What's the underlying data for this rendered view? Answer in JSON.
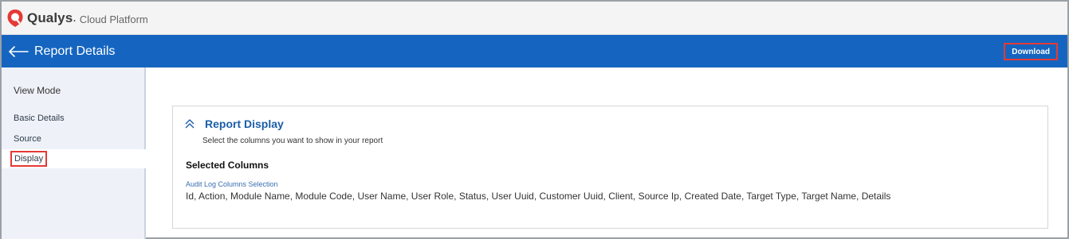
{
  "platform": {
    "brand": "Qualys",
    "brand_suffix": "Cloud Platform",
    "accent": "#e53935"
  },
  "header": {
    "back_icon": "arrow-left-icon",
    "title": "Report Details",
    "download_label": "Download",
    "background": "#1565c0"
  },
  "sidebar": {
    "heading": "View Mode",
    "items": [
      {
        "label": "Basic Details"
      },
      {
        "label": "Source"
      },
      {
        "label": "Display"
      }
    ],
    "active_index": 2
  },
  "main": {
    "section_title": "Report Display",
    "section_icon": "chevron-double-up-icon",
    "section_description": "Select the columns you want to show in your report",
    "selected_heading": "Selected Columns",
    "field_label": "Audit Log Columns Selection",
    "field_value": "Id, Action, Module Name, Module Code, User Name, User Role, Status, User Uuid, Customer Uuid, Client, Source Ip, Created Date, Target Type, Target Name, Details"
  }
}
